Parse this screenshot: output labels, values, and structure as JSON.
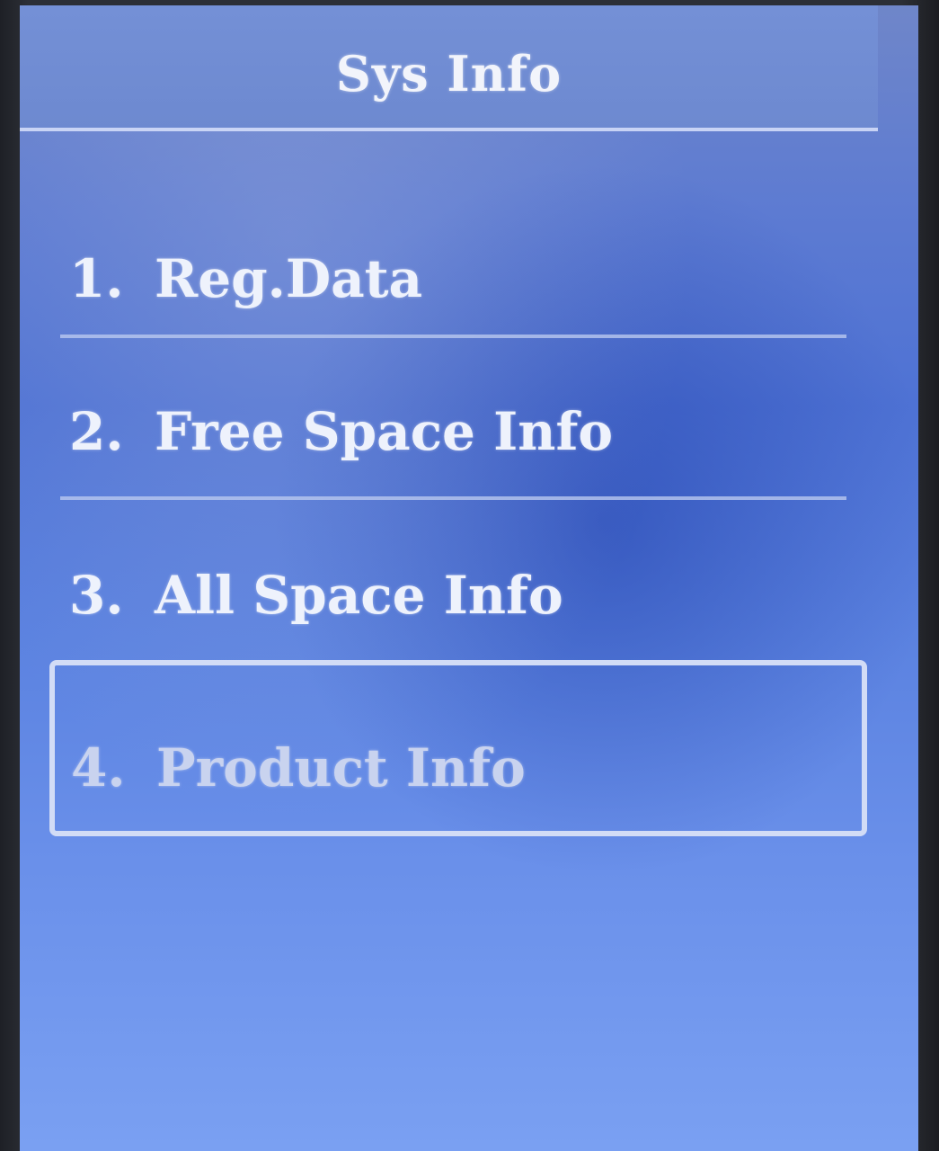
{
  "screen": {
    "title": "Sys Info"
  },
  "menu": {
    "items": [
      {
        "number": "1.",
        "label": "Reg.Data"
      },
      {
        "number": "2.",
        "label": "Free Space Info"
      },
      {
        "number": "3.",
        "label": "All Space Info"
      },
      {
        "number": "4.",
        "label": "Product Info",
        "selected": true
      }
    ]
  },
  "colors": {
    "screen_background": "#5b7fd8",
    "text": "#eef2fc",
    "selection_border": "#d2dcf6"
  }
}
